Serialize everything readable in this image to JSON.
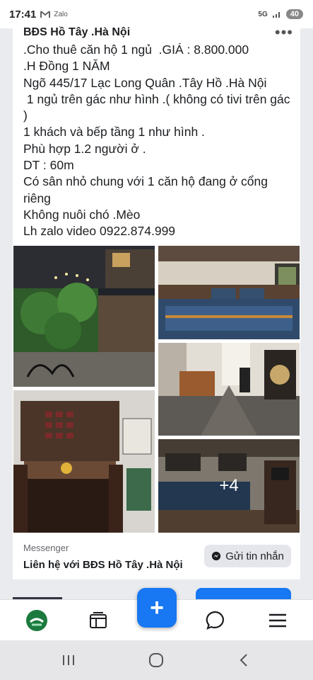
{
  "status_bar": {
    "time": "17:41",
    "left_icons": [
      "gmail-icon",
      "zalo-icon"
    ],
    "zalo_label": "Zalo",
    "network": "5G",
    "battery": "40"
  },
  "post": {
    "page_name": "BĐS Hồ Tây .Hà Nội",
    "lines": [
      ".Cho thuê căn hộ 1 ngủ  .GIÁ : 8.800.000",
      ".H Đồng 1 NĂM",
      "Ngõ 445/17 Lạc Long Quân .Tây Hồ .Hà Nội",
      " 1 ngủ trên gác như hình .( không có tivi trên gác )",
      "1 khách và bếp tầng 1 như hình .",
      "Phù hợp 1.2 người ở .",
      "DT : 60m",
      "Có sân nhỏ chung với 1 căn hộ đang ở cổng riêng",
      "Không nuôi chó .Mèo",
      "Lh zalo video 0922.874.999"
    ],
    "photos": [
      {
        "name": "photo-courtyard-night"
      },
      {
        "name": "photo-loft-bedroom"
      },
      {
        "name": "photo-living-room"
      },
      {
        "name": "photo-dining-room"
      },
      {
        "name": "photo-attic-bedroom"
      }
    ],
    "more_photos_label": "+4"
  },
  "messenger_cta": {
    "source_label": "Messenger",
    "title": "Liên hệ với BĐS Hồ Tây .Hà Nội",
    "button_label": "Gửi tin nhắn"
  },
  "bottom_nav": {
    "items": [
      "home-icon",
      "feeds-icon",
      "create-post-icon",
      "messenger-icon",
      "menu-icon"
    ],
    "fab_label": "+"
  },
  "system_nav": {
    "items": [
      "recent-apps-icon",
      "home-circle-icon",
      "back-icon"
    ]
  },
  "colors": {
    "accent": "#1877f2",
    "background": "#e9ebee"
  }
}
